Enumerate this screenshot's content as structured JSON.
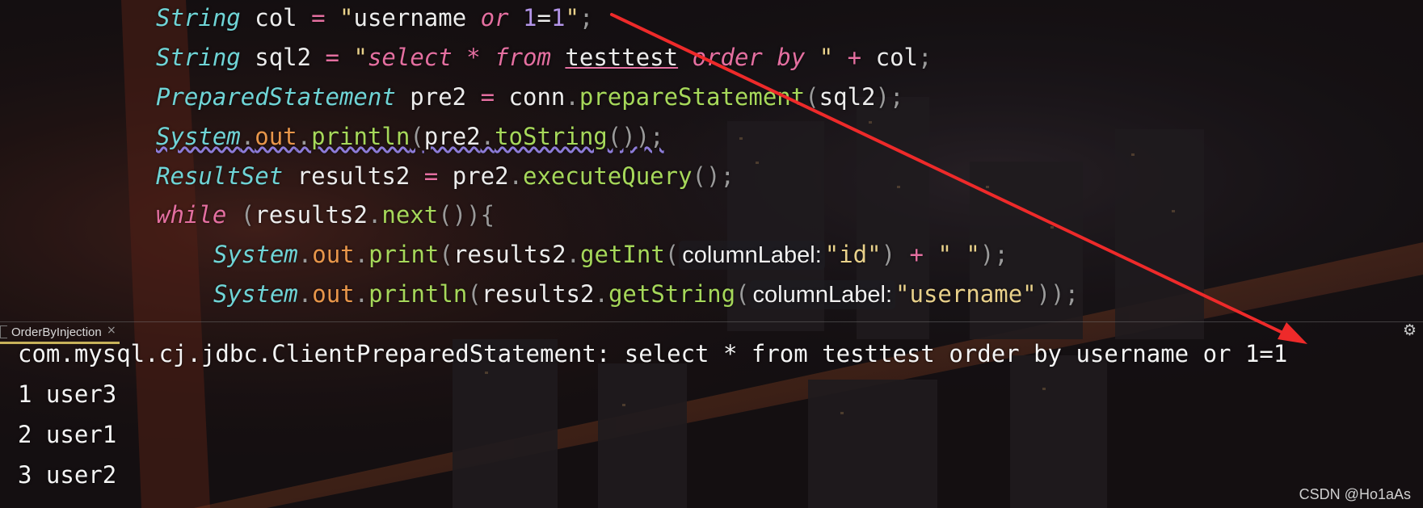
{
  "editor": {
    "line1": {
      "type": "String",
      "var": "col",
      "eq": "=",
      "q1": "\"",
      "str": "username ",
      "kw_or": "or",
      "sp": " ",
      "n1": "1",
      "eq2": "=",
      "n2": "1",
      "q2": "\"",
      "semi": ";"
    },
    "line2": {
      "type": "String",
      "var": "sql2",
      "eq": "=",
      "q1": "\"",
      "select": "select",
      "star": " * ",
      "from": "from",
      "sp1": " ",
      "table": "testtest",
      "sp2": " ",
      "order": "order",
      "sp3": " ",
      "by": "by",
      "q2": " \"",
      "plus": "+",
      "var2": "col",
      "semi": ";"
    },
    "line3": {
      "type": "PreparedStatement",
      "var": "pre2",
      "eq": "=",
      "obj": "conn",
      "dot": ".",
      "method": "prepareStatement",
      "lp": "(",
      "arg": "sql2",
      "rp": ");"
    },
    "line4": {
      "type": "System",
      "dot1": ".",
      "field": "out",
      "dot2": ".",
      "method": "println",
      "lp": "(",
      "obj": "pre2",
      "dot3": ".",
      "method2": "toString",
      "rp": "());"
    },
    "line5": {
      "type": "ResultSet",
      "var": "results2",
      "eq": "=",
      "obj": "pre2",
      "dot": ".",
      "method": "executeQuery",
      "rp": "();"
    },
    "line6": {
      "kw": "while",
      "lp": " (",
      "obj": "results2",
      "dot": ".",
      "method": "next",
      "rp": "()){"
    },
    "line7": {
      "type": "System",
      "dot1": ".",
      "field": "out",
      "dot2": ".",
      "method": "print",
      "lp": "(",
      "obj": "results2",
      "dot3": ".",
      "method2": "getInt",
      "lp2": "(",
      "hint": "columnLabel:",
      "str": "\"id\"",
      "rp": ")",
      "plus": "+",
      "str2": "\" \"",
      "end": ");"
    },
    "line8": {
      "type": "System",
      "dot1": ".",
      "field": "out",
      "dot2": ".",
      "method": "println",
      "lp": "(",
      "obj": "results2",
      "dot3": ".",
      "method2": "getString",
      "lp2": "(",
      "hint": "columnLabel:",
      "str": "\"username\"",
      "end": "));"
    }
  },
  "console": {
    "tab_label": "OrderByInjection",
    "close_icon": "close-icon",
    "settings_icon": "gear-icon",
    "output": [
      "com.mysql.cj.jdbc.ClientPreparedStatement: select * from testtest order by username or 1=1",
      "1 user3",
      "2 user1",
      "3 user2"
    ]
  },
  "watermark": "CSDN @Ho1aAs",
  "colors": {
    "arrow": "#ee2a2a",
    "tab_accent": "#c8b25a"
  }
}
